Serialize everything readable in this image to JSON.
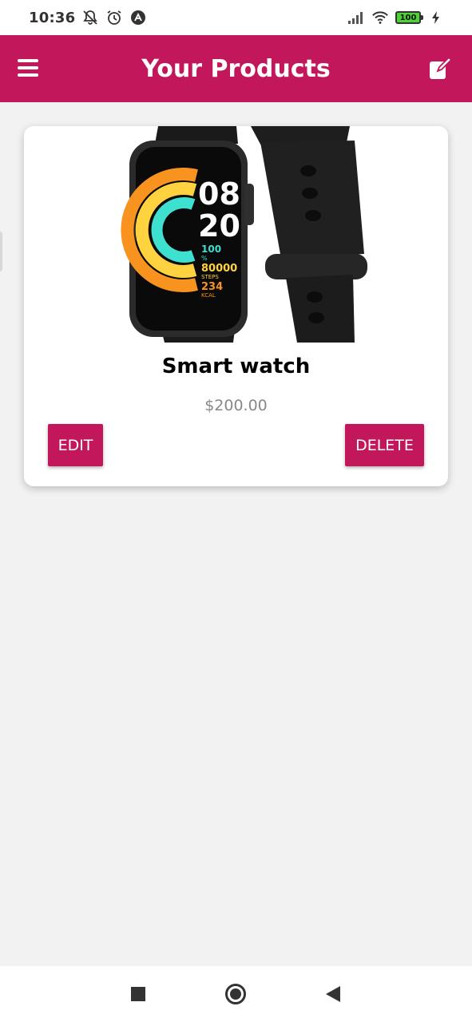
{
  "status_bar": {
    "time": "10:36",
    "battery": "100",
    "icons": [
      "muted-bell-icon",
      "alarm-clock-icon",
      "app-notification-icon",
      "signal-icon",
      "wifi-icon",
      "battery-icon",
      "charging-icon"
    ]
  },
  "app_bar": {
    "title": "Your Products",
    "left_icon": "menu-icon",
    "right_icon": "edit-icon"
  },
  "products": [
    {
      "title": "Smart watch",
      "price": "$200.00",
      "image": {
        "icon": "smart-watch-image",
        "time_hours": "08",
        "time_minutes": "20",
        "stat_percent": "100",
        "stat_percent_unit": "%",
        "steps": "80000",
        "steps_label": "STEPS",
        "kcal": "234",
        "kcal_label": "KCAL"
      },
      "edit_label": "EDIT",
      "delete_label": "DELETE"
    }
  ],
  "colors": {
    "primary": "#c2185b",
    "background": "#f2f2f2",
    "price": "#888888"
  },
  "nav_bar": {
    "icons": [
      "recent-apps-icon",
      "home-icon",
      "back-icon"
    ]
  }
}
